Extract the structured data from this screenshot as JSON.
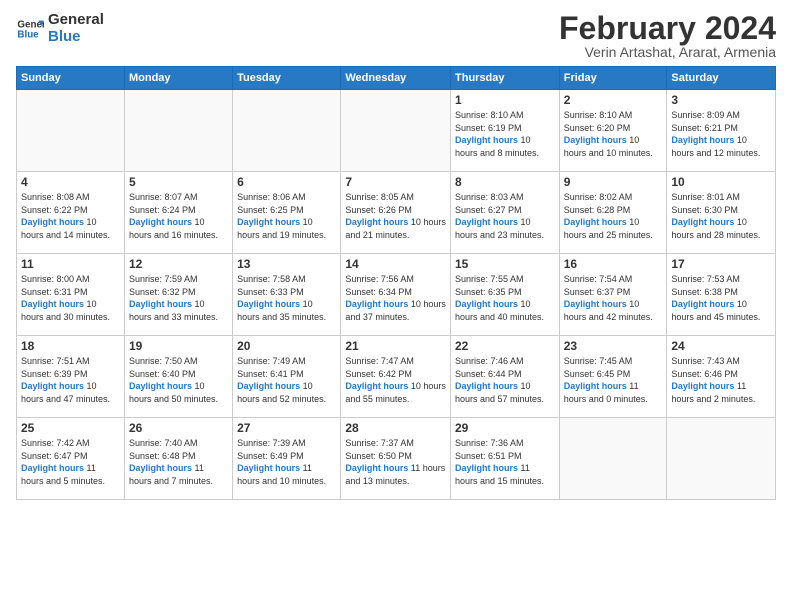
{
  "header": {
    "logo": {
      "line1": "General",
      "line2": "Blue"
    },
    "title": "February 2024",
    "subtitle": "Verin Artashat, Ararat, Armenia"
  },
  "days_of_week": [
    "Sunday",
    "Monday",
    "Tuesday",
    "Wednesday",
    "Thursday",
    "Friday",
    "Saturday"
  ],
  "weeks": [
    [
      {
        "day": "",
        "info": ""
      },
      {
        "day": "",
        "info": ""
      },
      {
        "day": "",
        "info": ""
      },
      {
        "day": "",
        "info": ""
      },
      {
        "day": "1",
        "sunrise": "Sunrise: 8:10 AM",
        "sunset": "Sunset: 6:19 PM",
        "daylight": "Daylight: 10 hours and 8 minutes."
      },
      {
        "day": "2",
        "sunrise": "Sunrise: 8:10 AM",
        "sunset": "Sunset: 6:20 PM",
        "daylight": "Daylight: 10 hours and 10 minutes."
      },
      {
        "day": "3",
        "sunrise": "Sunrise: 8:09 AM",
        "sunset": "Sunset: 6:21 PM",
        "daylight": "Daylight: 10 hours and 12 minutes."
      }
    ],
    [
      {
        "day": "4",
        "sunrise": "Sunrise: 8:08 AM",
        "sunset": "Sunset: 6:22 PM",
        "daylight": "Daylight: 10 hours and 14 minutes."
      },
      {
        "day": "5",
        "sunrise": "Sunrise: 8:07 AM",
        "sunset": "Sunset: 6:24 PM",
        "daylight": "Daylight: 10 hours and 16 minutes."
      },
      {
        "day": "6",
        "sunrise": "Sunrise: 8:06 AM",
        "sunset": "Sunset: 6:25 PM",
        "daylight": "Daylight: 10 hours and 19 minutes."
      },
      {
        "day": "7",
        "sunrise": "Sunrise: 8:05 AM",
        "sunset": "Sunset: 6:26 PM",
        "daylight": "Daylight: 10 hours and 21 minutes."
      },
      {
        "day": "8",
        "sunrise": "Sunrise: 8:03 AM",
        "sunset": "Sunset: 6:27 PM",
        "daylight": "Daylight: 10 hours and 23 minutes."
      },
      {
        "day": "9",
        "sunrise": "Sunrise: 8:02 AM",
        "sunset": "Sunset: 6:28 PM",
        "daylight": "Daylight: 10 hours and 25 minutes."
      },
      {
        "day": "10",
        "sunrise": "Sunrise: 8:01 AM",
        "sunset": "Sunset: 6:30 PM",
        "daylight": "Daylight: 10 hours and 28 minutes."
      }
    ],
    [
      {
        "day": "11",
        "sunrise": "Sunrise: 8:00 AM",
        "sunset": "Sunset: 6:31 PM",
        "daylight": "Daylight: 10 hours and 30 minutes."
      },
      {
        "day": "12",
        "sunrise": "Sunrise: 7:59 AM",
        "sunset": "Sunset: 6:32 PM",
        "daylight": "Daylight: 10 hours and 33 minutes."
      },
      {
        "day": "13",
        "sunrise": "Sunrise: 7:58 AM",
        "sunset": "Sunset: 6:33 PM",
        "daylight": "Daylight: 10 hours and 35 minutes."
      },
      {
        "day": "14",
        "sunrise": "Sunrise: 7:56 AM",
        "sunset": "Sunset: 6:34 PM",
        "daylight": "Daylight: 10 hours and 37 minutes."
      },
      {
        "day": "15",
        "sunrise": "Sunrise: 7:55 AM",
        "sunset": "Sunset: 6:35 PM",
        "daylight": "Daylight: 10 hours and 40 minutes."
      },
      {
        "day": "16",
        "sunrise": "Sunrise: 7:54 AM",
        "sunset": "Sunset: 6:37 PM",
        "daylight": "Daylight: 10 hours and 42 minutes."
      },
      {
        "day": "17",
        "sunrise": "Sunrise: 7:53 AM",
        "sunset": "Sunset: 6:38 PM",
        "daylight": "Daylight: 10 hours and 45 minutes."
      }
    ],
    [
      {
        "day": "18",
        "sunrise": "Sunrise: 7:51 AM",
        "sunset": "Sunset: 6:39 PM",
        "daylight": "Daylight: 10 hours and 47 minutes."
      },
      {
        "day": "19",
        "sunrise": "Sunrise: 7:50 AM",
        "sunset": "Sunset: 6:40 PM",
        "daylight": "Daylight: 10 hours and 50 minutes."
      },
      {
        "day": "20",
        "sunrise": "Sunrise: 7:49 AM",
        "sunset": "Sunset: 6:41 PM",
        "daylight": "Daylight: 10 hours and 52 minutes."
      },
      {
        "day": "21",
        "sunrise": "Sunrise: 7:47 AM",
        "sunset": "Sunset: 6:42 PM",
        "daylight": "Daylight: 10 hours and 55 minutes."
      },
      {
        "day": "22",
        "sunrise": "Sunrise: 7:46 AM",
        "sunset": "Sunset: 6:44 PM",
        "daylight": "Daylight: 10 hours and 57 minutes."
      },
      {
        "day": "23",
        "sunrise": "Sunrise: 7:45 AM",
        "sunset": "Sunset: 6:45 PM",
        "daylight": "Daylight: 11 hours and 0 minutes."
      },
      {
        "day": "24",
        "sunrise": "Sunrise: 7:43 AM",
        "sunset": "Sunset: 6:46 PM",
        "daylight": "Daylight: 11 hours and 2 minutes."
      }
    ],
    [
      {
        "day": "25",
        "sunrise": "Sunrise: 7:42 AM",
        "sunset": "Sunset: 6:47 PM",
        "daylight": "Daylight: 11 hours and 5 minutes."
      },
      {
        "day": "26",
        "sunrise": "Sunrise: 7:40 AM",
        "sunset": "Sunset: 6:48 PM",
        "daylight": "Daylight: 11 hours and 7 minutes."
      },
      {
        "day": "27",
        "sunrise": "Sunrise: 7:39 AM",
        "sunset": "Sunset: 6:49 PM",
        "daylight": "Daylight: 11 hours and 10 minutes."
      },
      {
        "day": "28",
        "sunrise": "Sunrise: 7:37 AM",
        "sunset": "Sunset: 6:50 PM",
        "daylight": "Daylight: 11 hours and 13 minutes."
      },
      {
        "day": "29",
        "sunrise": "Sunrise: 7:36 AM",
        "sunset": "Sunset: 6:51 PM",
        "daylight": "Daylight: 11 hours and 15 minutes."
      },
      {
        "day": "",
        "info": ""
      },
      {
        "day": "",
        "info": ""
      }
    ]
  ],
  "colors": {
    "header_bg": "#2779c4",
    "header_text": "#ffffff",
    "accent": "#2779c4"
  }
}
